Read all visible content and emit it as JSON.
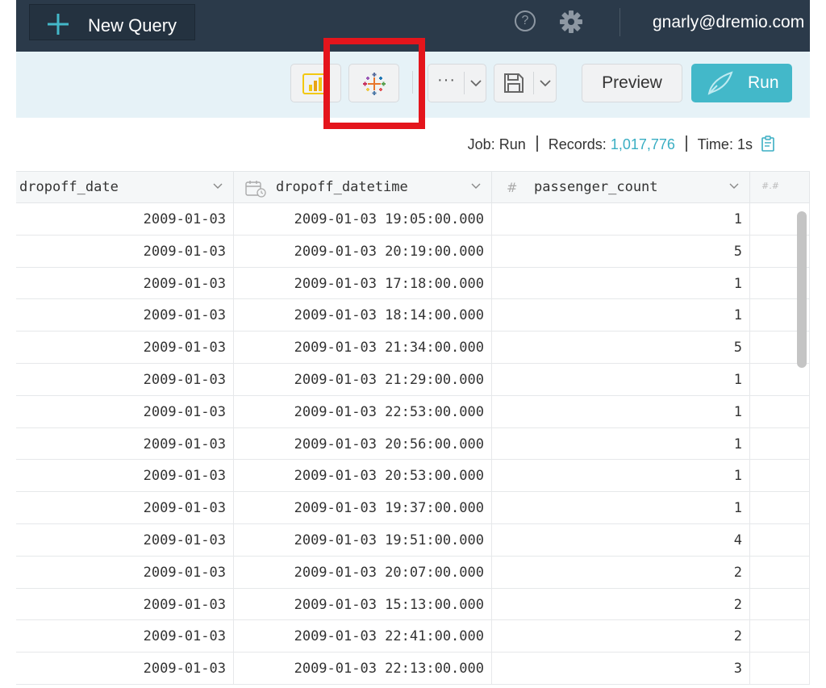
{
  "header": {
    "new_query_label": "New Query",
    "help_symbol": "?",
    "user_email": "gnarly@dremio.com"
  },
  "toolbar": {
    "more_label": "···",
    "preview_label": "Preview",
    "run_label": "Run",
    "accent_color": "#43b8c9",
    "highlight_color": "#e4151c"
  },
  "job_status": {
    "job_label": "Job:",
    "job_value": "Run",
    "records_label": "Records:",
    "records_value": "1,017,776",
    "time_label": "Time:",
    "time_value": "1s"
  },
  "table": {
    "columns": [
      {
        "name": "dropoff_date",
        "icon": "date-icon"
      },
      {
        "name": "dropoff_datetime",
        "icon": "calendar-clock-icon"
      },
      {
        "name": "passenger_count",
        "icon": "hash-icon"
      },
      {
        "name": "",
        "icon": "decimal-icon"
      }
    ],
    "rows": [
      [
        "2009-01-03",
        "2009-01-03 19:05:00.000",
        "1"
      ],
      [
        "2009-01-03",
        "2009-01-03 20:19:00.000",
        "5"
      ],
      [
        "2009-01-03",
        "2009-01-03 17:18:00.000",
        "1"
      ],
      [
        "2009-01-03",
        "2009-01-03 18:14:00.000",
        "1"
      ],
      [
        "2009-01-03",
        "2009-01-03 21:34:00.000",
        "5"
      ],
      [
        "2009-01-03",
        "2009-01-03 21:29:00.000",
        "1"
      ],
      [
        "2009-01-03",
        "2009-01-03 22:53:00.000",
        "1"
      ],
      [
        "2009-01-03",
        "2009-01-03 20:56:00.000",
        "1"
      ],
      [
        "2009-01-03",
        "2009-01-03 20:53:00.000",
        "1"
      ],
      [
        "2009-01-03",
        "2009-01-03 19:37:00.000",
        "1"
      ],
      [
        "2009-01-03",
        "2009-01-03 19:51:00.000",
        "4"
      ],
      [
        "2009-01-03",
        "2009-01-03 20:07:00.000",
        "2"
      ],
      [
        "2009-01-03",
        "2009-01-03 15:13:00.000",
        "2"
      ],
      [
        "2009-01-03",
        "2009-01-03 22:41:00.000",
        "2"
      ],
      [
        "2009-01-03",
        "2009-01-03 22:13:00.000",
        "3"
      ]
    ]
  }
}
